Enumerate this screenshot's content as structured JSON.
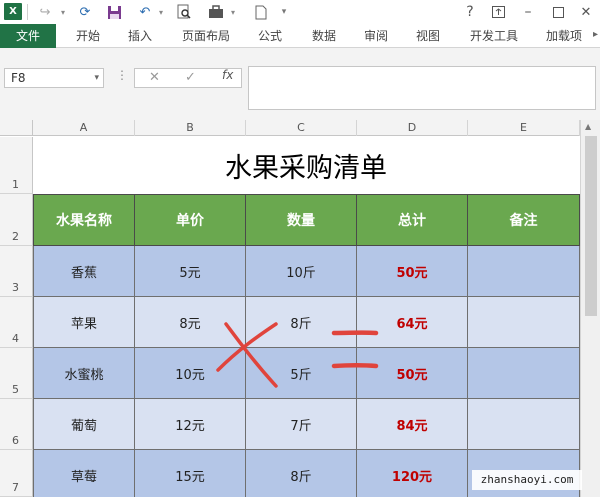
{
  "toolbar": {
    "app_icon_label": "X",
    "help": "?",
    "icons": [
      "excel-logo-icon",
      "redo-icon",
      "refresh-icon",
      "save-icon",
      "undo-icon",
      "print-preview-icon",
      "briefcase-icon",
      "new-file-icon",
      "customize-qat-icon"
    ]
  },
  "ribbon": {
    "tabs": [
      "文件",
      "开始",
      "插入",
      "页面布局",
      "公式",
      "数据",
      "审阅",
      "视图",
      "开发工具",
      "加载项"
    ]
  },
  "formula_bar": {
    "name_box": "F8",
    "fx_label": "fx",
    "cancel": "✕",
    "enter": "✓",
    "content": ""
  },
  "sheet": {
    "columns": [
      "A",
      "B",
      "C",
      "D",
      "E"
    ],
    "rows": [
      "1",
      "2",
      "3",
      "4",
      "5",
      "6",
      "7"
    ],
    "title": "水果采购清单",
    "header": [
      "水果名称",
      "单价",
      "数量",
      "总计",
      "备注"
    ],
    "data": [
      [
        "香蕉",
        "5元",
        "10斤",
        "50元",
        ""
      ],
      [
        "苹果",
        "8元",
        "8斤",
        "64元",
        ""
      ],
      [
        "水蜜桃",
        "10元",
        "5斤",
        "50元",
        ""
      ],
      [
        "葡萄",
        "12元",
        "7斤",
        "84元",
        ""
      ],
      [
        "草莓",
        "15元",
        "8斤",
        "120元",
        ""
      ]
    ]
  },
  "colors": {
    "ribbon_file": "#217346",
    "header_fill": "#6aa84f",
    "band_dark": "#b4c6e7",
    "band_light": "#d9e1f2",
    "total_text": "#c00000",
    "annotation": "#e0443c"
  },
  "watermark": "zhanshaoyi.com"
}
